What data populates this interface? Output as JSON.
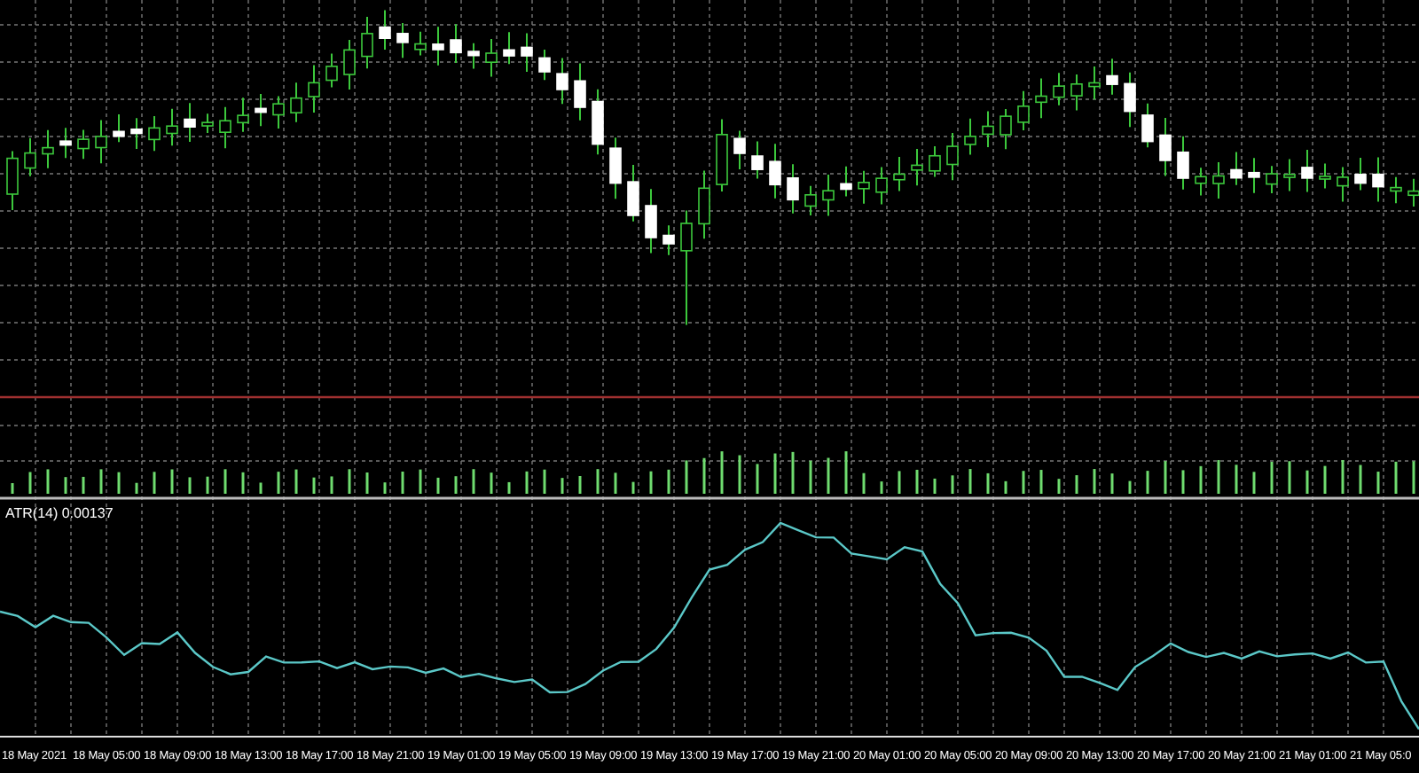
{
  "indicator_panel": {
    "label": "ATR(14) 0.00137"
  },
  "time_axis": {
    "labels": [
      "18 May 2021",
      "18 May 05:00",
      "18 May 09:00",
      "18 May 13:00",
      "18 May 17:00",
      "18 May 21:00",
      "19 May 01:00",
      "19 May 05:00",
      "19 May 09:00",
      "19 May 13:00",
      "19 May 17:00",
      "19 May 21:00",
      "20 May 01:00",
      "20 May 05:00",
      "20 May 09:00",
      "20 May 13:00",
      "20 May 17:00",
      "20 May 21:00",
      "21 May 01:00",
      "21 May 05:0"
    ]
  }
}
